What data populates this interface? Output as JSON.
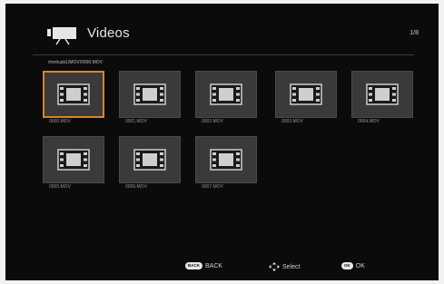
{
  "header": {
    "title": "Videos",
    "page_counter": "1/8",
    "icon": "video-camera-icon"
  },
  "path": "/mnt/usb1/MOV/0000.MOV",
  "files": [
    {
      "name": "0000.MOV",
      "selected": true
    },
    {
      "name": "0001.MOV",
      "selected": false
    },
    {
      "name": "0002.MOV",
      "selected": false
    },
    {
      "name": "0003.MOV",
      "selected": false
    },
    {
      "name": "0004.MOV",
      "selected": false
    },
    {
      "name": "0005.MOV",
      "selected": false
    },
    {
      "name": "0006.MOV",
      "selected": false
    },
    {
      "name": "0007.MOV",
      "selected": false
    }
  ],
  "footer": {
    "back_key": "BACK",
    "back_label": "BACK",
    "select_label": "Select",
    "ok_key": "OK",
    "ok_label": "OK"
  },
  "colors": {
    "background": "#0b0b0b",
    "selection": "#e0802a",
    "thumbnail": "#3a3a3a"
  }
}
